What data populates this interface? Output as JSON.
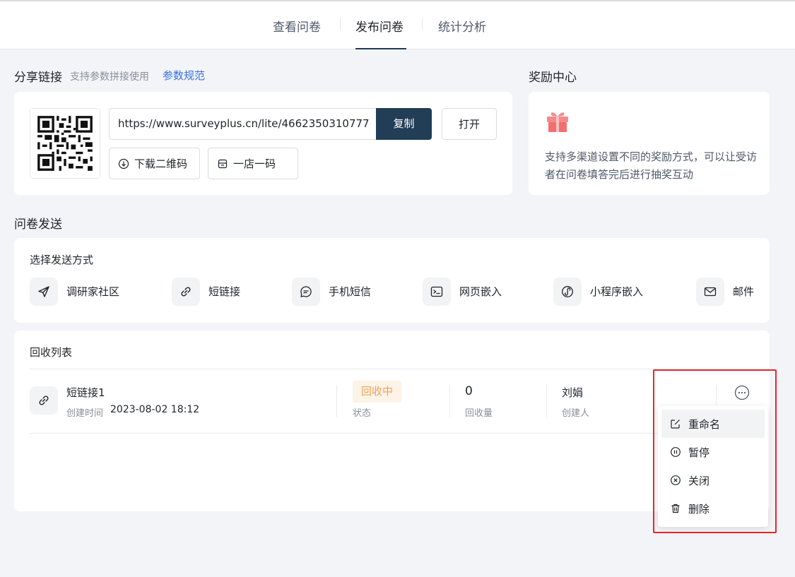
{
  "tabs": [
    {
      "label": "查看问卷",
      "active": false
    },
    {
      "label": "发布问卷",
      "active": true
    },
    {
      "label": "统计分析",
      "active": false
    }
  ],
  "share": {
    "title": "分享链接",
    "hint": "支持参数拼接使用",
    "link_label": "参数规范",
    "url": "https://www.surveyplus.cn/lite/4662350310777",
    "copy_label": "复制",
    "open_label": "打开",
    "download_qr_label": "下载二维码",
    "store_code_label": "一店一码"
  },
  "reward": {
    "title": "奖励中心",
    "description": "支持多渠道设置不同的奖励方式，可以让受访者在问卷填答完后进行抽奖互动"
  },
  "send": {
    "title": "问卷发送",
    "subtitle": "选择发送方式",
    "methods": [
      {
        "label": "调研家社区",
        "icon": "paper-plane-icon"
      },
      {
        "label": "短链接",
        "icon": "link-icon"
      },
      {
        "label": "手机短信",
        "icon": "message-icon"
      },
      {
        "label": "网页嵌入",
        "icon": "terminal-icon"
      },
      {
        "label": "小程序嵌入",
        "icon": "mini-program-icon"
      },
      {
        "label": "邮件",
        "icon": "mail-icon"
      }
    ]
  },
  "recovery": {
    "title": "回收列表",
    "rows": [
      {
        "name": "短链接1",
        "created_label": "创建时间",
        "created_time": "2023-08-02 18:12",
        "status": "回收中",
        "status_label": "状态",
        "count": "0",
        "count_label": "回收量",
        "creator": "刘娟",
        "creator_label": "创建人"
      }
    ]
  },
  "dropdown": {
    "items": [
      {
        "label": "重命名",
        "icon": "edit-icon"
      },
      {
        "label": "暂停",
        "icon": "pause-icon"
      },
      {
        "label": "关闭",
        "icon": "close-circle-icon"
      },
      {
        "label": "删除",
        "icon": "trash-icon"
      }
    ]
  },
  "colors": {
    "accent": "#223d56",
    "link": "#3370e6",
    "status_bg": "#fdf3e6",
    "status_text": "#f0a35b",
    "highlight": "#e6262b"
  }
}
